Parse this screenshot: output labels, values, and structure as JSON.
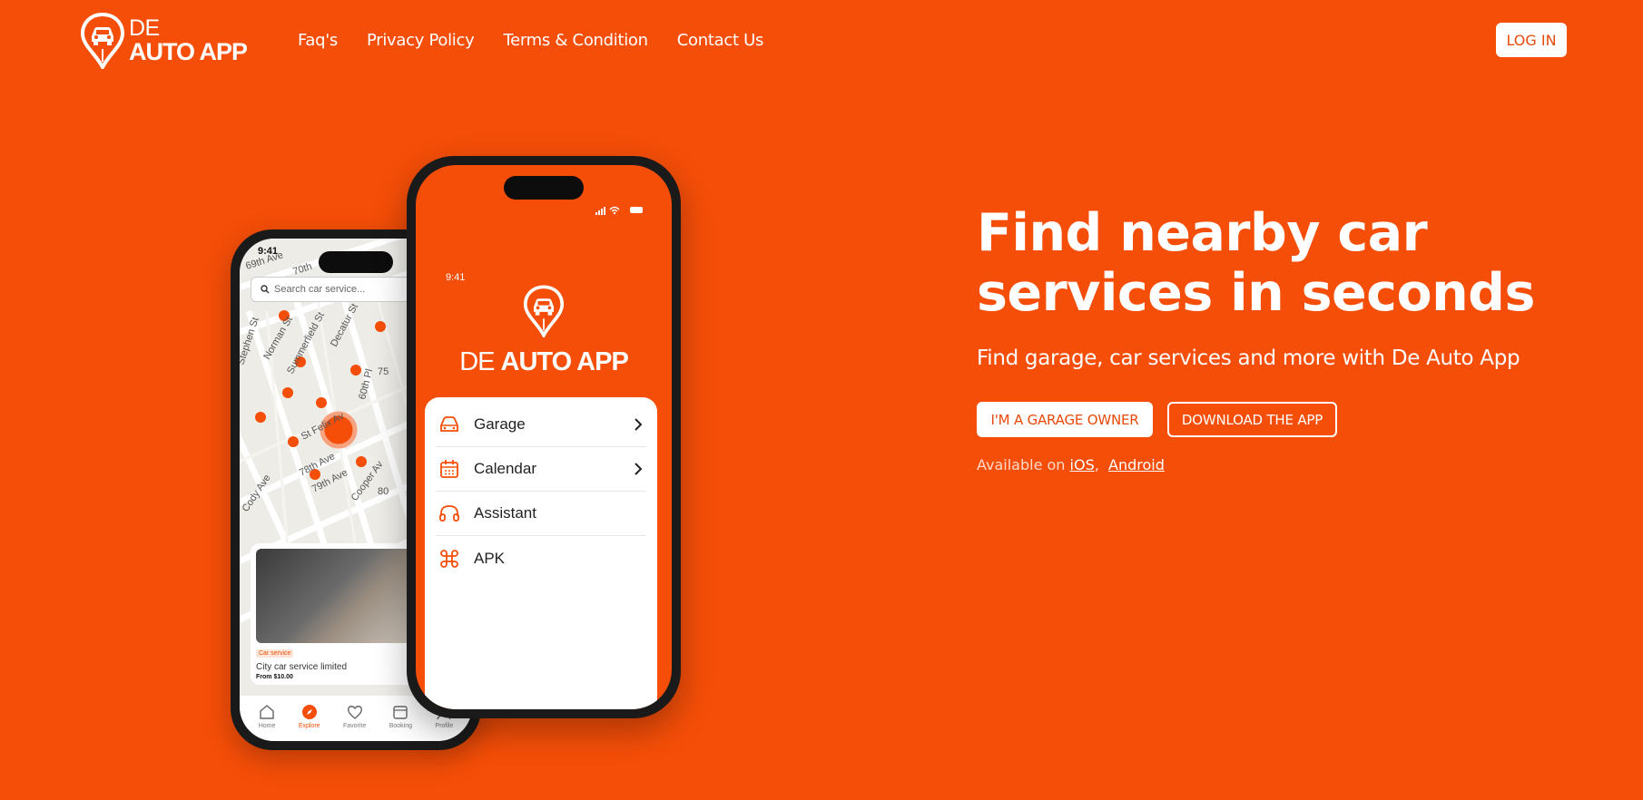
{
  "brand": {
    "line1": "DE",
    "line2": "AUTO APP"
  },
  "nav": {
    "items": [
      "Faq's",
      "Privacy Policy",
      "Terms & Condition",
      "Contact Us"
    ]
  },
  "header": {
    "login_label": "LOG IN"
  },
  "hero": {
    "title": "Find nearby car services in seconds",
    "subtitle": "Find garage, car services and more with De Auto App",
    "owner_button": "I'M A GARAGE OWNER",
    "download_button": "DOWNLOAD THE APP",
    "available_prefix": "Available on",
    "ios_link": "iOS",
    "separator": ",",
    "android_link": "Android"
  },
  "phone_back": {
    "time": "9:41",
    "search_placeholder": "Search car service...",
    "streets": [
      "69th Ave",
      "70th",
      "Stephen St",
      "Norman St",
      "Summerfield St",
      "Decatur St",
      "60th Pl",
      "75",
      "St Felix Av",
      "78th Ave",
      "79th Ave",
      "Cooper Av",
      "Cody Ave",
      "80"
    ],
    "card": {
      "badge": "Car service",
      "title": "City car service limited",
      "price": "From $10.00"
    },
    "tabs": [
      "Home",
      "Explore",
      "Favorite",
      "Booking",
      "Profile"
    ],
    "active_tab": "Explore"
  },
  "phone_front": {
    "time": "9:41",
    "logo_light": "DE",
    "logo_bold": "AUTO APP",
    "menu": [
      {
        "label": "Garage",
        "icon": "car-icon",
        "chevron": true
      },
      {
        "label": "Calendar",
        "icon": "calendar-icon",
        "chevron": true
      },
      {
        "label": "Assistant",
        "icon": "headset-icon",
        "chevron": false
      },
      {
        "label": "APK",
        "icon": "command-icon",
        "chevron": false
      }
    ]
  },
  "colors": {
    "brand": "#F54E08",
    "accent": "#E8490B",
    "white": "#FFFFFF"
  }
}
